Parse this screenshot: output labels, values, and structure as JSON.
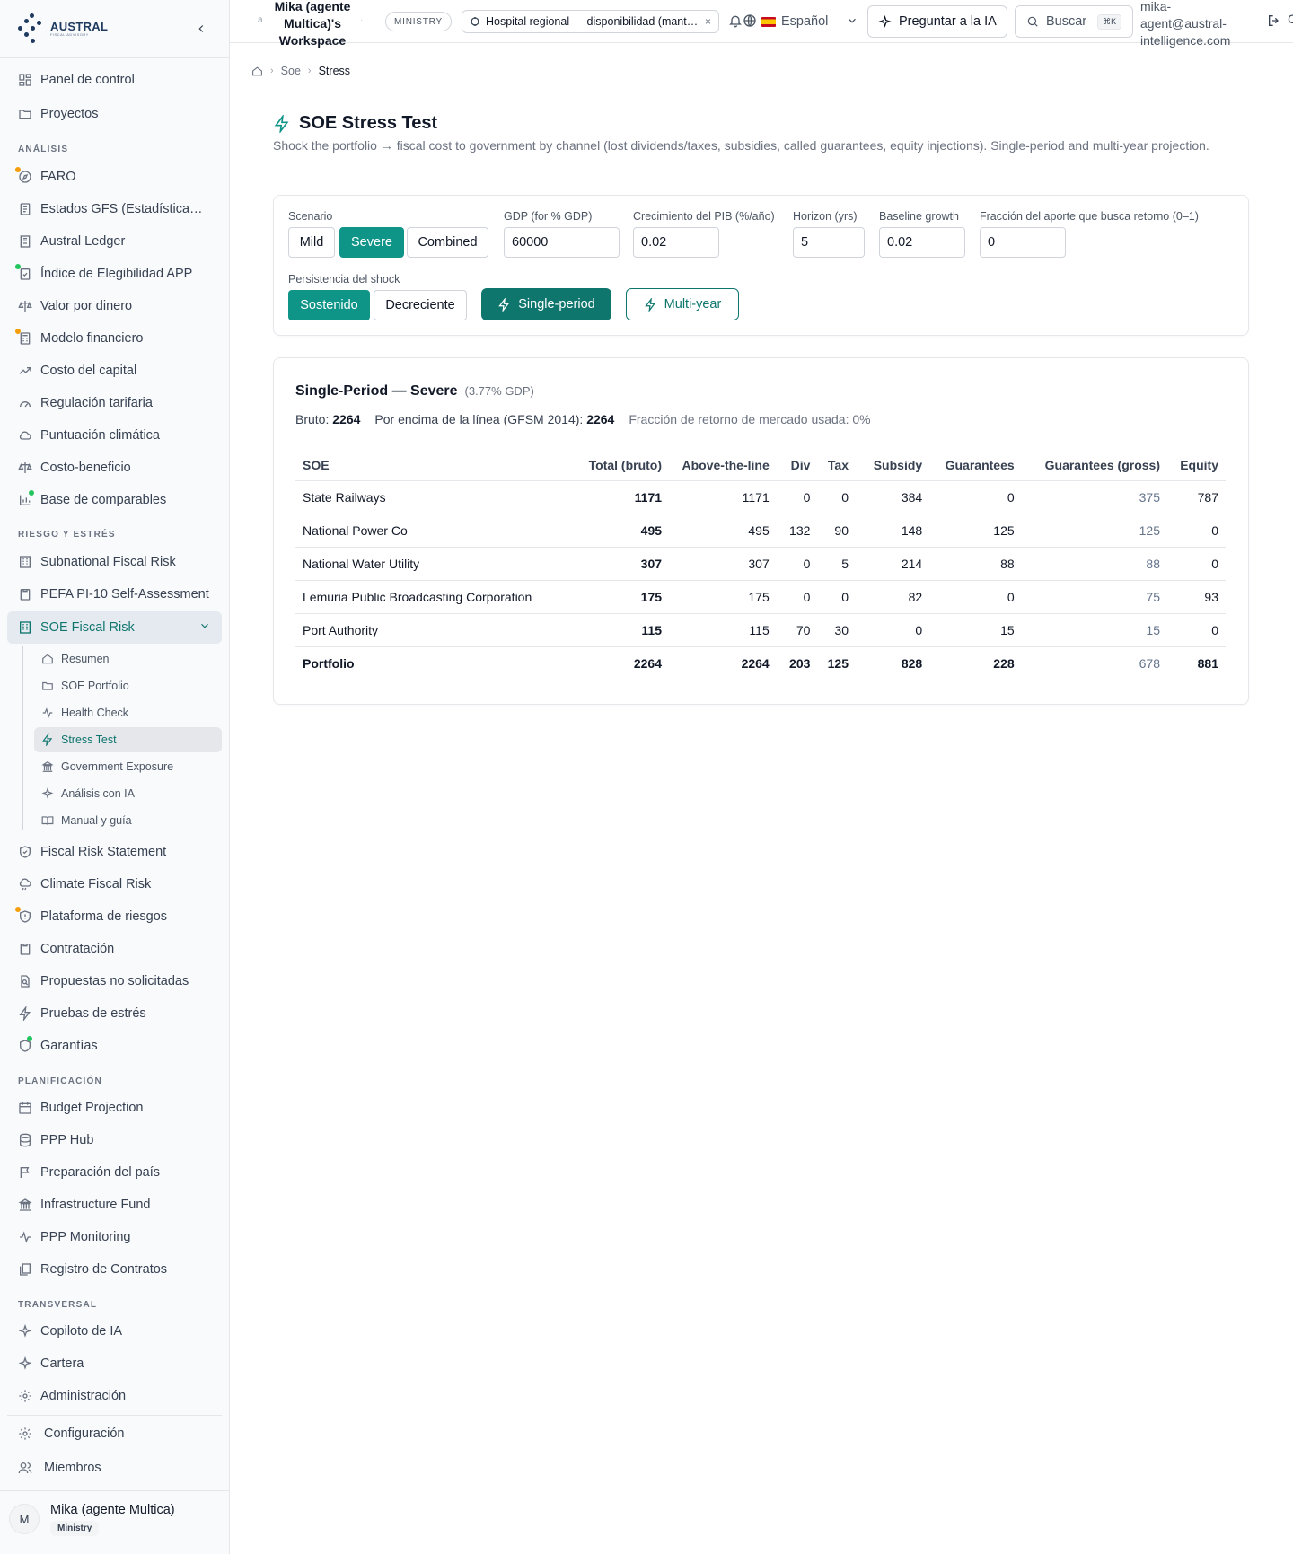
{
  "brand": {
    "name": "AUSTRAL",
    "tagline": "FISCAL ADVISORY"
  },
  "sidebar": {
    "top_items": [
      {
        "label": "Panel de control",
        "icon": "dashboard-icon"
      },
      {
        "label": "Proyectos",
        "icon": "folder-icon"
      }
    ],
    "sections": {
      "analisis": "ANÁLISIS",
      "riesgo": "RIESGO Y ESTRÉS",
      "planificacion": "PLANIFICACIÓN",
      "transversal": "TRANSVERSAL"
    },
    "analisis_items": [
      {
        "label": "FARO",
        "icon": "compass-icon",
        "dot": "orange"
      },
      {
        "label": "Estados GFS (Estadísticas de Finanzas Públicas)",
        "icon": "report-icon",
        "dot": ""
      },
      {
        "label": "Austral Ledger",
        "icon": "ledger-icon",
        "dot": ""
      },
      {
        "label": "Índice de Elegibilidad APP",
        "icon": "clipboard-check-icon",
        "dot": "green"
      },
      {
        "label": "Valor por dinero",
        "icon": "scale-icon",
        "dot": ""
      },
      {
        "label": "Modelo financiero",
        "icon": "calculator-icon",
        "dot": "orange"
      },
      {
        "label": "Costo del capital",
        "icon": "trending-up-icon",
        "dot": ""
      },
      {
        "label": "Regulación tarifaria",
        "icon": "gauge-icon",
        "dot": ""
      },
      {
        "label": "Puntuación climática",
        "icon": "cloud-icon",
        "dot": ""
      },
      {
        "label": "Costo-beneficio",
        "icon": "scale-icon",
        "dot": ""
      },
      {
        "label": "Base de comparables",
        "icon": "bar-chart-icon",
        "dot": "green"
      }
    ],
    "riesgo_items": [
      {
        "label": "Subnational Fiscal Risk",
        "icon": "building-icon",
        "dot": ""
      },
      {
        "label": "PEFA PI-10 Self-Assessment",
        "icon": "clipboard-icon",
        "dot": ""
      },
      {
        "label": "SOE Fiscal Risk",
        "icon": "building-icon",
        "dot": ""
      }
    ],
    "soe_subitems": [
      {
        "label": "Resumen",
        "icon": "home-icon"
      },
      {
        "label": "SOE Portfolio",
        "icon": "folder-icon"
      },
      {
        "label": "Health Check",
        "icon": "activity-icon"
      },
      {
        "label": "Stress Test",
        "icon": "zap-icon"
      },
      {
        "label": "Government Exposure",
        "icon": "landmark-icon"
      },
      {
        "label": "Análisis con IA",
        "icon": "sparkles-icon"
      },
      {
        "label": "Manual y guía",
        "icon": "book-icon"
      }
    ],
    "riesgo_items_after": [
      {
        "label": "Fiscal Risk Statement",
        "icon": "shield-check-icon",
        "dot": ""
      },
      {
        "label": "Climate Fiscal Risk",
        "icon": "cloud-rain-icon",
        "dot": ""
      },
      {
        "label": "Plataforma de riesgos",
        "icon": "shield-alert-icon",
        "dot": "orange"
      },
      {
        "label": "Contratación",
        "icon": "clipboard-icon",
        "dot": ""
      },
      {
        "label": "Propuestas no solicitadas",
        "icon": "file-search-icon",
        "dot": ""
      },
      {
        "label": "Pruebas de estrés",
        "icon": "zap-icon",
        "dot": ""
      },
      {
        "label": "Garantías",
        "icon": "shield-icon",
        "dot": "green"
      }
    ],
    "planificacion_items": [
      {
        "label": "Budget Projection",
        "icon": "calendar-icon"
      },
      {
        "label": "PPP Hub",
        "icon": "database-icon"
      },
      {
        "label": "Preparación del país",
        "icon": "flag-icon"
      },
      {
        "label": "Infrastructure Fund",
        "icon": "landmark-icon"
      },
      {
        "label": "PPP Monitoring",
        "icon": "activity-icon"
      },
      {
        "label": "Registro de Contratos",
        "icon": "files-icon"
      }
    ],
    "transversal_items": [
      {
        "label": "Copiloto de IA",
        "icon": "sparkles-icon"
      },
      {
        "label": "Cartera",
        "icon": "sparkles-icon"
      },
      {
        "label": "Administración",
        "icon": "gear-icon"
      }
    ],
    "bottom_items": [
      {
        "label": "Configuración",
        "icon": "gear-icon"
      },
      {
        "label": "Miembros",
        "icon": "users-icon"
      }
    ],
    "user": {
      "initial": "M",
      "name": "Mika (agente Multica)",
      "role": "Ministry"
    }
  },
  "topbar": {
    "workspace_letter": "a",
    "workspace_name": "Mika (agente Multica)'s Workspace",
    "workspace_sep": "·",
    "role_pill": "MINISTRY",
    "project": "Hospital regional — disponibilidad (mantenimiento)",
    "project_close": "×",
    "language": "Español",
    "ask_ai": "Preguntar a la IA",
    "search": "Buscar",
    "search_kbd": "⌘K",
    "email": "mika-agent@austral-intelligence.com",
    "edge_char": "C"
  },
  "breadcrumb": {
    "sep": "›",
    "items": [
      "Soe",
      "Stress"
    ]
  },
  "page": {
    "title": "SOE Stress Test",
    "description": "Shock the portfolio → fiscal cost to government by channel (lost dividends/taxes, subsidies, called guarantees, equity injections). Single-period and multi-year projection."
  },
  "controls": {
    "scenario_label": "Scenario",
    "scenarios": [
      "Mild",
      "Severe",
      "Combined"
    ],
    "scenario_selected": "Severe",
    "gdp_label": "GDP (for % GDP)",
    "gdp_value": "60000",
    "growth_label": "Crecimiento del PIB (%/año)",
    "growth_value": "0.02",
    "horizon_label": "Horizon (yrs)",
    "horizon_value": "5",
    "baseline_label": "Baseline growth",
    "baseline_value": "0.02",
    "fraction_label": "Fracción del aporte que busca retorno (0–1)",
    "fraction_value": "0",
    "persistence_label": "Persistencia del shock",
    "persistence": [
      "Sostenido",
      "Decreciente"
    ],
    "persistence_selected": "Sostenido",
    "run_single": "Single-period",
    "run_multi": "Multi-year"
  },
  "results": {
    "title": "Single-Period — Severe",
    "gdp_pct": "(3.77% GDP)",
    "gross_label": "Bruto:",
    "gross_value": "2264",
    "atl_label": "Por encima de la línea (GFSM 2014):",
    "atl_value": "2264",
    "market_note": "Fracción de retorno de mercado usada: 0%",
    "columns": [
      "SOE",
      "Total (bruto)",
      "Above-the-line",
      "Div",
      "Tax",
      "Subsidy",
      "Guarantees",
      "Guarantees (gross)",
      "Equity"
    ],
    "rows": [
      [
        "State Railways",
        "1171",
        "1171",
        "0",
        "0",
        "384",
        "0",
        "375",
        "787"
      ],
      [
        "National Power Co",
        "495",
        "495",
        "132",
        "90",
        "148",
        "125",
        "125",
        "0"
      ],
      [
        "National Water Utility",
        "307",
        "307",
        "0",
        "5",
        "214",
        "88",
        "88",
        "0"
      ],
      [
        "Lemuria Public Broadcasting Corporation",
        "175",
        "175",
        "0",
        "0",
        "82",
        "0",
        "75",
        "93"
      ],
      [
        "Port Authority",
        "115",
        "115",
        "70",
        "30",
        "0",
        "15",
        "15",
        "0"
      ]
    ],
    "total": [
      "Portfolio",
      "2264",
      "2264",
      "203",
      "125",
      "828",
      "228",
      "678",
      "881"
    ]
  },
  "colors": {
    "accent": "#0f9488",
    "accent_dark": "#0f766e",
    "dot_orange": "#f59e0b",
    "dot_green": "#22c55e"
  }
}
